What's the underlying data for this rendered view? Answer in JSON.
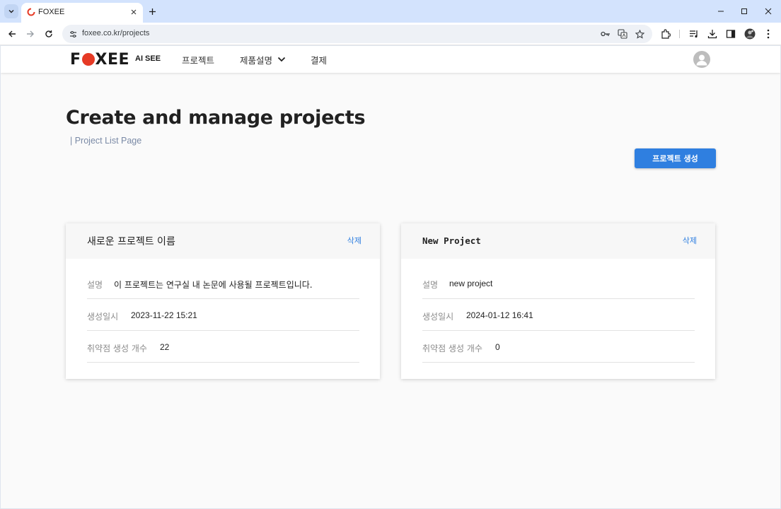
{
  "browser": {
    "tab_title": "FOXEE",
    "url": "foxee.co.kr/projects"
  },
  "site": {
    "logo_text": "FOXEE",
    "logo_sub": "AI SEE",
    "nav": {
      "projects": "프로젝트",
      "product": "제품설명",
      "payment": "결제"
    }
  },
  "main": {
    "title": "Create and manage projects",
    "subtitle": "| Project List Page",
    "create_button": "프로젝트 생성"
  },
  "labels": {
    "description": "설명",
    "created_at": "생성일시",
    "vuln_count": "취약점 생성 개수",
    "delete": "삭제"
  },
  "projects": [
    {
      "name": "새로운 프로젝트 이름",
      "description": "이 프로젝트는 연구실 내 논문에 사용될 프로젝트입니다.",
      "created_at": "2023-11-22 15:21",
      "vuln_count": "22"
    },
    {
      "name": "New Project",
      "description": "new project",
      "created_at": "2024-01-12 16:41",
      "vuln_count": "0"
    }
  ],
  "colors": {
    "accent": "#2f7fe0",
    "logo_red": "#e63a25",
    "tabbar": "#d3e3fd",
    "page_bg": "#fafafa"
  }
}
